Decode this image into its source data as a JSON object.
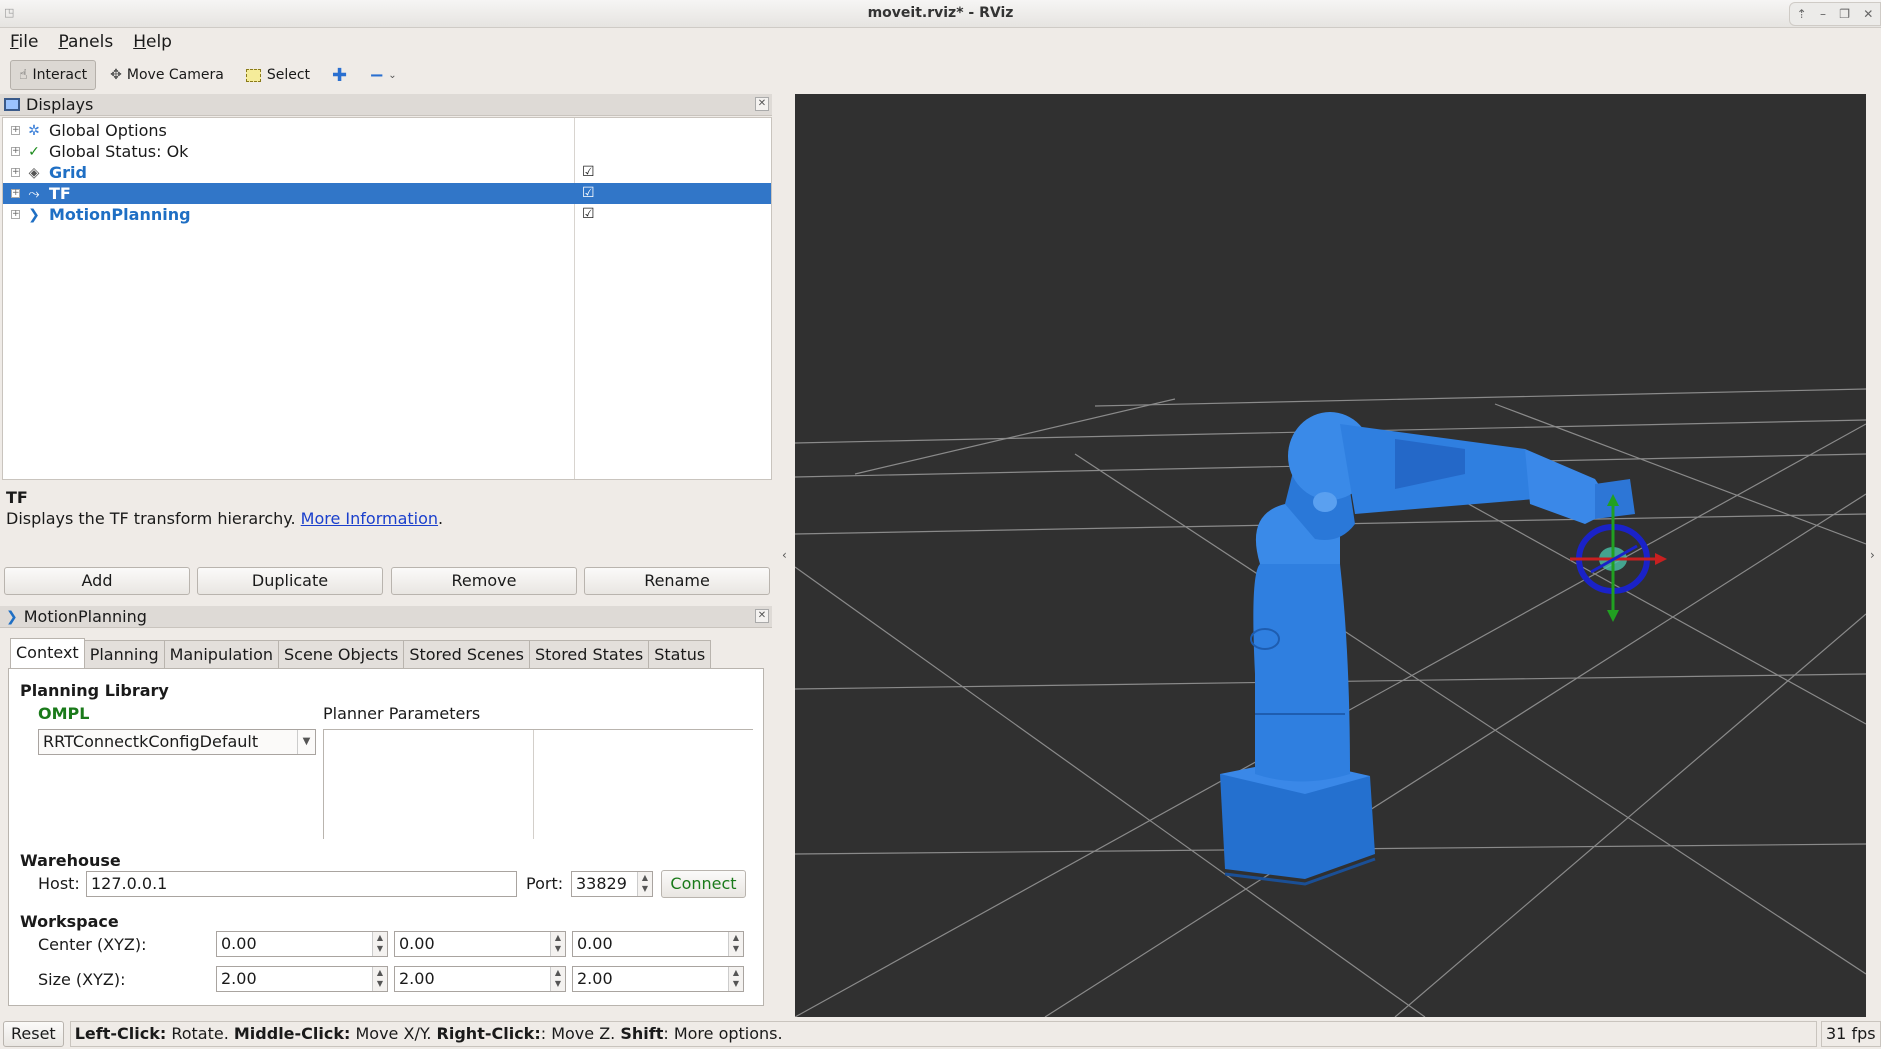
{
  "window": {
    "title": "moveit.rviz* - RViz"
  },
  "menu": {
    "items": [
      "File",
      "Panels",
      "Help"
    ]
  },
  "toolbar": {
    "interact": "Interact",
    "move_camera": "Move Camera",
    "select": "Select"
  },
  "displays": {
    "title": "Displays",
    "items": [
      {
        "label": "Global Options",
        "icon": "gear-icon"
      },
      {
        "label": "Global Status: Ok",
        "icon": "checkmark-icon"
      },
      {
        "label": "Grid",
        "icon": "grid-icon",
        "checked": true
      },
      {
        "label": "TF",
        "icon": "tf-icon",
        "checked": true,
        "selected": true
      },
      {
        "label": "MotionPlanning",
        "icon": "motionplanning-icon",
        "checked": true
      }
    ]
  },
  "description": {
    "title": "TF",
    "text": "Displays the TF transform hierarchy.",
    "link": "More Information",
    "period": "."
  },
  "panel_buttons": {
    "add": "Add",
    "duplicate": "Duplicate",
    "remove": "Remove",
    "rename": "Rename"
  },
  "motion_planning": {
    "title": "MotionPlanning",
    "tabs": [
      "Context",
      "Planning",
      "Manipulation",
      "Scene Objects",
      "Stored Scenes",
      "Stored States",
      "Status"
    ],
    "active_tab": "Context",
    "planning_library": {
      "heading": "Planning Library",
      "library": "OMPL",
      "planner": "RRTConnectkConfigDefault",
      "params_heading": "Planner Parameters"
    },
    "warehouse": {
      "heading": "Warehouse",
      "host_label": "Host:",
      "host": "127.0.0.1",
      "port_label": "Port:",
      "port": "33829",
      "connect": "Connect"
    },
    "workspace": {
      "heading": "Workspace",
      "center_label": "Center (XYZ):",
      "center": [
        "0.00",
        "0.00",
        "0.00"
      ],
      "size_label": "Size (XYZ):",
      "size": [
        "2.00",
        "2.00",
        "2.00"
      ]
    }
  },
  "statusbar": {
    "reset": "Reset",
    "left_click": "Left-Click:",
    "rotate": " Rotate. ",
    "middle_click": "Middle-Click:",
    "move_xy": " Move X/Y. ",
    "right_click": "Right-Click:",
    "move_z": ": Move Z. ",
    "shift": "Shift",
    "more": ": More options.",
    "fps": "31 fps"
  },
  "colors": {
    "selection": "#3176c8",
    "robot": "#2f7fe0",
    "viewport_bg": "#303030",
    "ompl": "#1a7a1a"
  }
}
